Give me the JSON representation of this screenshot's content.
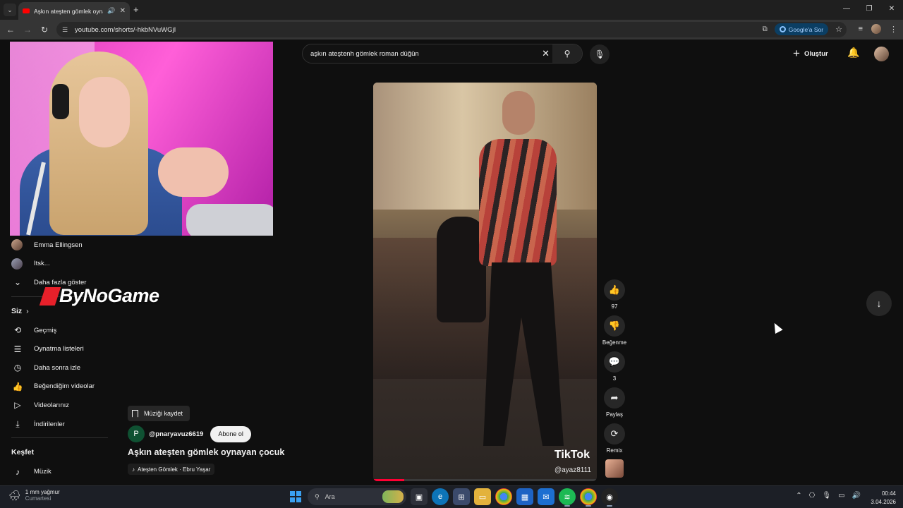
{
  "browser": {
    "tab_title": "Aşkın ateşten gömlek oyna",
    "url": "youtube.com/shorts/-hkbNVuWGjI",
    "google_sor": "Google'a Sor"
  },
  "masthead": {
    "search_query": "aşkın ateştenh gömlek roman düğün",
    "create_label": "Oluştur"
  },
  "overlay_logo": "ByNoGame",
  "sidebar": {
    "subscriptions": [
      {
        "label": "Emma Ellingsen"
      },
      {
        "label": "Itsk..."
      }
    ],
    "show_more": "Daha fazla göster",
    "you_header": "Siz",
    "you_items": [
      {
        "label": "Geçmiş",
        "icon": "history-icon"
      },
      {
        "label": "Oynatma listeleri",
        "icon": "playlists-icon"
      },
      {
        "label": "Daha sonra izle",
        "icon": "watch-later-icon"
      },
      {
        "label": "Beğendiğim videolar",
        "icon": "liked-icon"
      },
      {
        "label": "Videolarınız",
        "icon": "your-videos-icon"
      },
      {
        "label": "İndirilenler",
        "icon": "download-icon"
      }
    ],
    "explore_header": "Keşfet",
    "explore_items": [
      {
        "label": "Müzik",
        "icon": "music-icon"
      }
    ]
  },
  "short": {
    "save_music": "Müziği kaydet",
    "channel_initial": "P",
    "channel_name": "@pnaryavuz6619",
    "subscribe": "Abone ol",
    "title": "Aşkın ateşten gömlek oynayan çocuk",
    "song": "Ateşten Gömlek · Ebru Yaşar",
    "watermark": "TikTok",
    "watermark_handle": "@ayaz8111",
    "progress": 0.14
  },
  "actions": {
    "likes": "97",
    "dislike": "Beğenme",
    "comments": "3",
    "share": "Paylaş",
    "remix": "Remix"
  },
  "taskbar": {
    "weather_line1": "1 mm yağmur",
    "weather_line2": "Cumartesi",
    "search": "Ara",
    "time": "00:44",
    "date": "3.04.2026"
  }
}
